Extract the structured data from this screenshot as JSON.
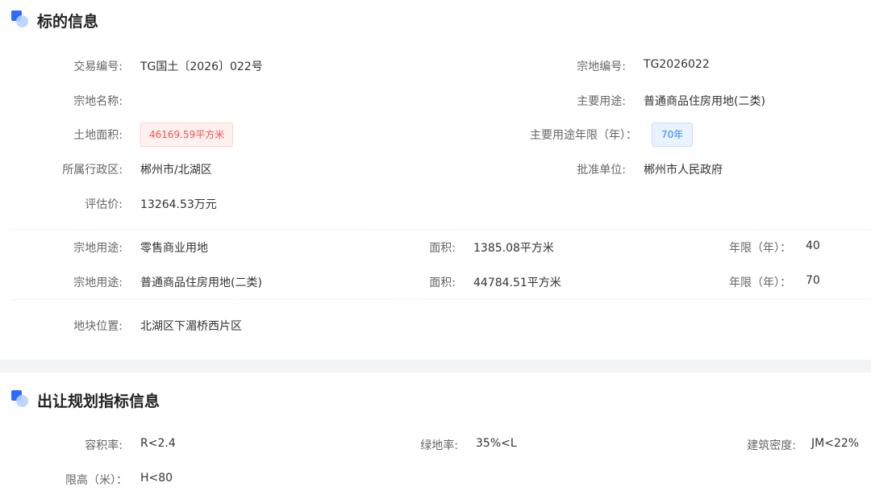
{
  "section1": {
    "title": "标的信息",
    "trade_no_label": "交易编号:",
    "trade_no_value": "TG国土〔2026〕022号",
    "parcel_no_label": "宗地编号:",
    "parcel_no_value": "TG2026022",
    "parcel_name_label": "宗地名称:",
    "parcel_name_value": "",
    "main_use_label": "主要用途:",
    "main_use_value": "普通商品住房用地(二类)",
    "land_area_label": "土地面积:",
    "land_area_value": "46169.59平方米",
    "main_use_years_label": "主要用途年限（年）：",
    "main_use_years_value": "70年",
    "district_label": "所属行政区:",
    "district_value": "郴州市/北湖区",
    "approver_label": "批准单位:",
    "approver_value": "郴州市人民政府",
    "appraisal_label": "评估价:",
    "appraisal_value": "13264.53万元",
    "uses": [
      {
        "use_label": "宗地用途:",
        "use_value": "零售商业用地",
        "area_label": "面积:",
        "area_value": "1385.08平方米",
        "years_label": "年限（年）：",
        "years_value": "40"
      },
      {
        "use_label": "宗地用途:",
        "use_value": "普通商品住房用地(二类)",
        "area_label": "面积:",
        "area_value": "44784.51平方米",
        "years_label": "年限（年）：",
        "years_value": "70"
      }
    ],
    "location_label": "地块位置:",
    "location_value": "北湖区下湄桥西片区"
  },
  "section2": {
    "title": "出让规划指标信息",
    "far_label": "容积率:",
    "far_value": "R<2.4",
    "green_label": "绿地率:",
    "green_value": "35%<L",
    "density_label": "建筑密度:",
    "density_value": "JM<22%",
    "height_label": "限高（米）：",
    "height_value": "H<80"
  },
  "colors": {
    "accent": "#2f6bff",
    "tag_red": "#f0524f",
    "tag_blue": "#2f89ff"
  }
}
